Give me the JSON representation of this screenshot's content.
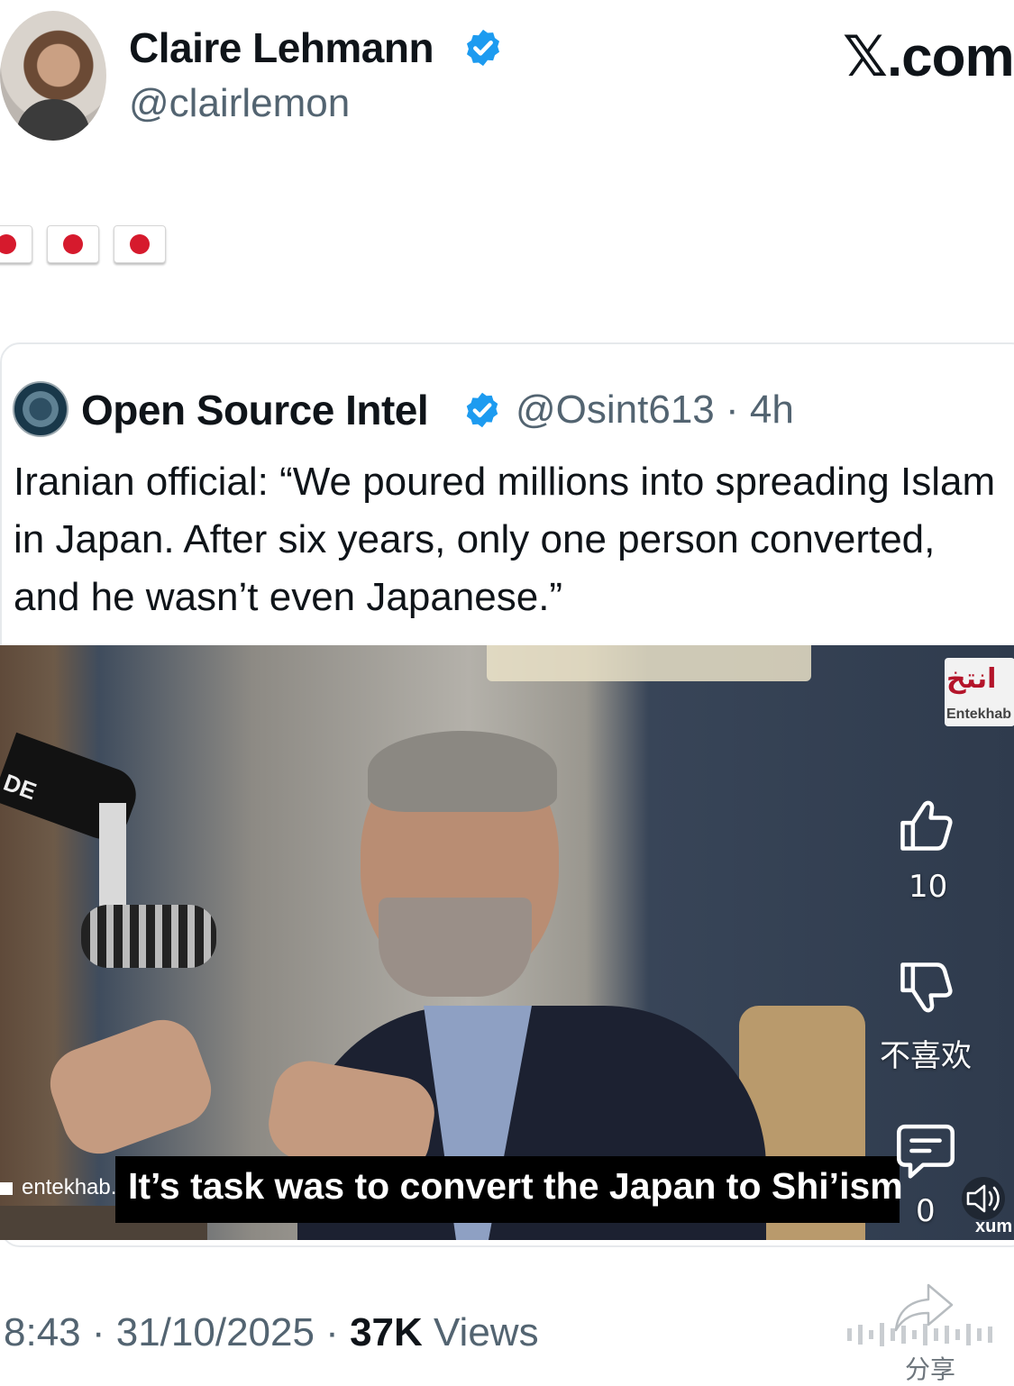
{
  "author": {
    "name": "Claire Lehmann",
    "handle": "@clairlemon",
    "verified": true
  },
  "brand": "𝕏.com",
  "post": {
    "emoji_text": "🇯🇵🇯🇵🇯🇵",
    "timestamp": "8:43 · 31/10/2025 · ",
    "views_count": "37K",
    "views_label": " Views"
  },
  "quoted_post": {
    "name": "Open Source Intel",
    "verified": true,
    "meta": "@Osint613 · 4h",
    "text": "Iranian official: “We poured millions into spreading Islam in Japan. After six years, only one person converted, and he wasn’t even Japanese.”"
  },
  "video": {
    "caption": "It’s task was to convert the Japan to Shi’ism",
    "source_label": "entekhab.i",
    "watermark": "Entekhab",
    "watermark_mark": "انتخ"
  },
  "actions": {
    "like_count": "10",
    "dislike_label": "不喜欢",
    "comment_count": "0",
    "share_label": "分享",
    "player_logo": "xum"
  },
  "colors": {
    "verified_blue": "#1d9bf0",
    "text_primary": "#0f1419",
    "text_secondary": "#536471",
    "caption_bg": "#000000",
    "flag_red": "#d61a2d"
  },
  "icons": [
    "verified-badge-icon",
    "like-icon",
    "dislike-icon",
    "comment-icon",
    "volume-icon",
    "share-icon"
  ]
}
